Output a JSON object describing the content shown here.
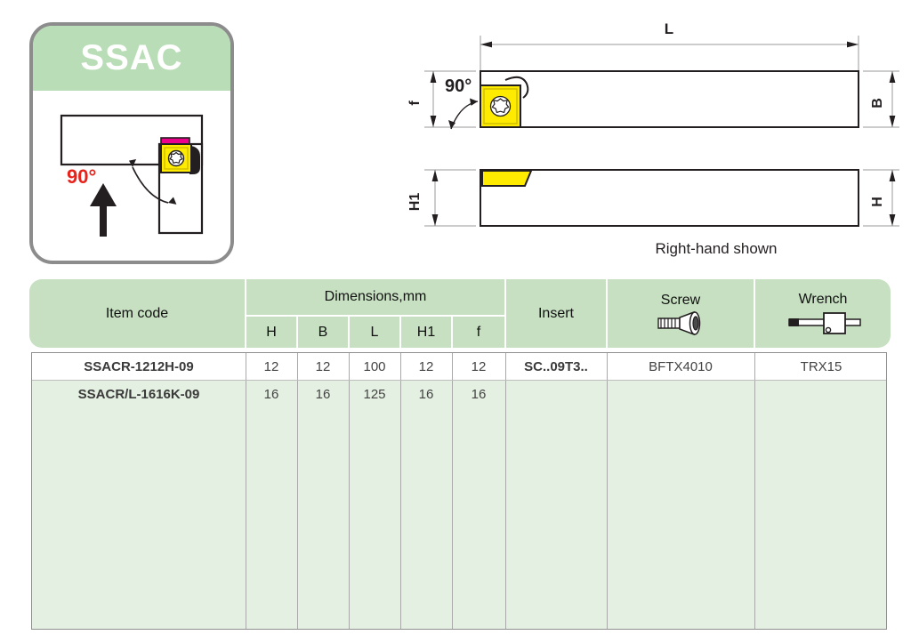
{
  "card": {
    "title": "SSAC",
    "angle_label": "90°",
    "accent_green": "#b9ddb6",
    "angle_color": "#e8231c",
    "insert_color": "#ffeb00",
    "edge_color": "#ec008c",
    "border_color": "#8c8c8c"
  },
  "diagrams": {
    "top_view": {
      "length_label": "L",
      "width_label": "B",
      "f_label": "f",
      "angle_label": "90°"
    },
    "side_view": {
      "h1_label": "H1",
      "h_label": "H"
    },
    "caption": "Right-hand shown"
  },
  "table": {
    "header": {
      "item_code": "Item code",
      "dimensions": "Dimensions,mm",
      "dim_cols": [
        "H",
        "B",
        "L",
        "H1",
        "f"
      ],
      "insert": "Insert",
      "screw": "Screw",
      "wrench": "Wrench",
      "screw_icon": "screw-icon",
      "wrench_icon": "wrench-icon",
      "header_bg": "#c6e0c1"
    },
    "rows": [
      {
        "item_code": "SSACR-1212H-09",
        "H": "12",
        "B": "12",
        "L": "100",
        "H1": "12",
        "f": "12",
        "insert": "SC..09T3..",
        "screw": "BFTX4010",
        "wrench": "TRX15"
      },
      {
        "item_code": "SSACR/L-1616K-09",
        "H": "16",
        "B": "16",
        "L": "125",
        "H1": "16",
        "f": "16",
        "insert": "",
        "screw": "",
        "wrench": ""
      }
    ]
  }
}
